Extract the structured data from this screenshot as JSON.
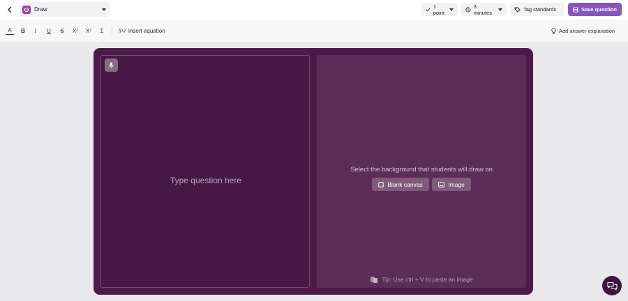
{
  "topbar": {
    "question_type": "Draw",
    "points": "1 point",
    "time": "3 minutes",
    "tag_standards": "Tag standards",
    "save_question": "Save question"
  },
  "toolbar": {
    "bold": "B",
    "italic": "I",
    "underline": "U",
    "strike": "S",
    "insert_equation": "Insert equation",
    "add_answer_explanation": "Add answer explanation"
  },
  "question": {
    "placeholder": "Type question here"
  },
  "background": {
    "prompt": "Select the background that students will draw on",
    "blank_canvas": "Blank canvas",
    "image": "Image",
    "tip": "Tip: Use ctrl + V to paste an image"
  },
  "colors": {
    "accent": "#8854c0",
    "card": "#4e1a4a",
    "draw_badge": "#9a3fa0"
  }
}
